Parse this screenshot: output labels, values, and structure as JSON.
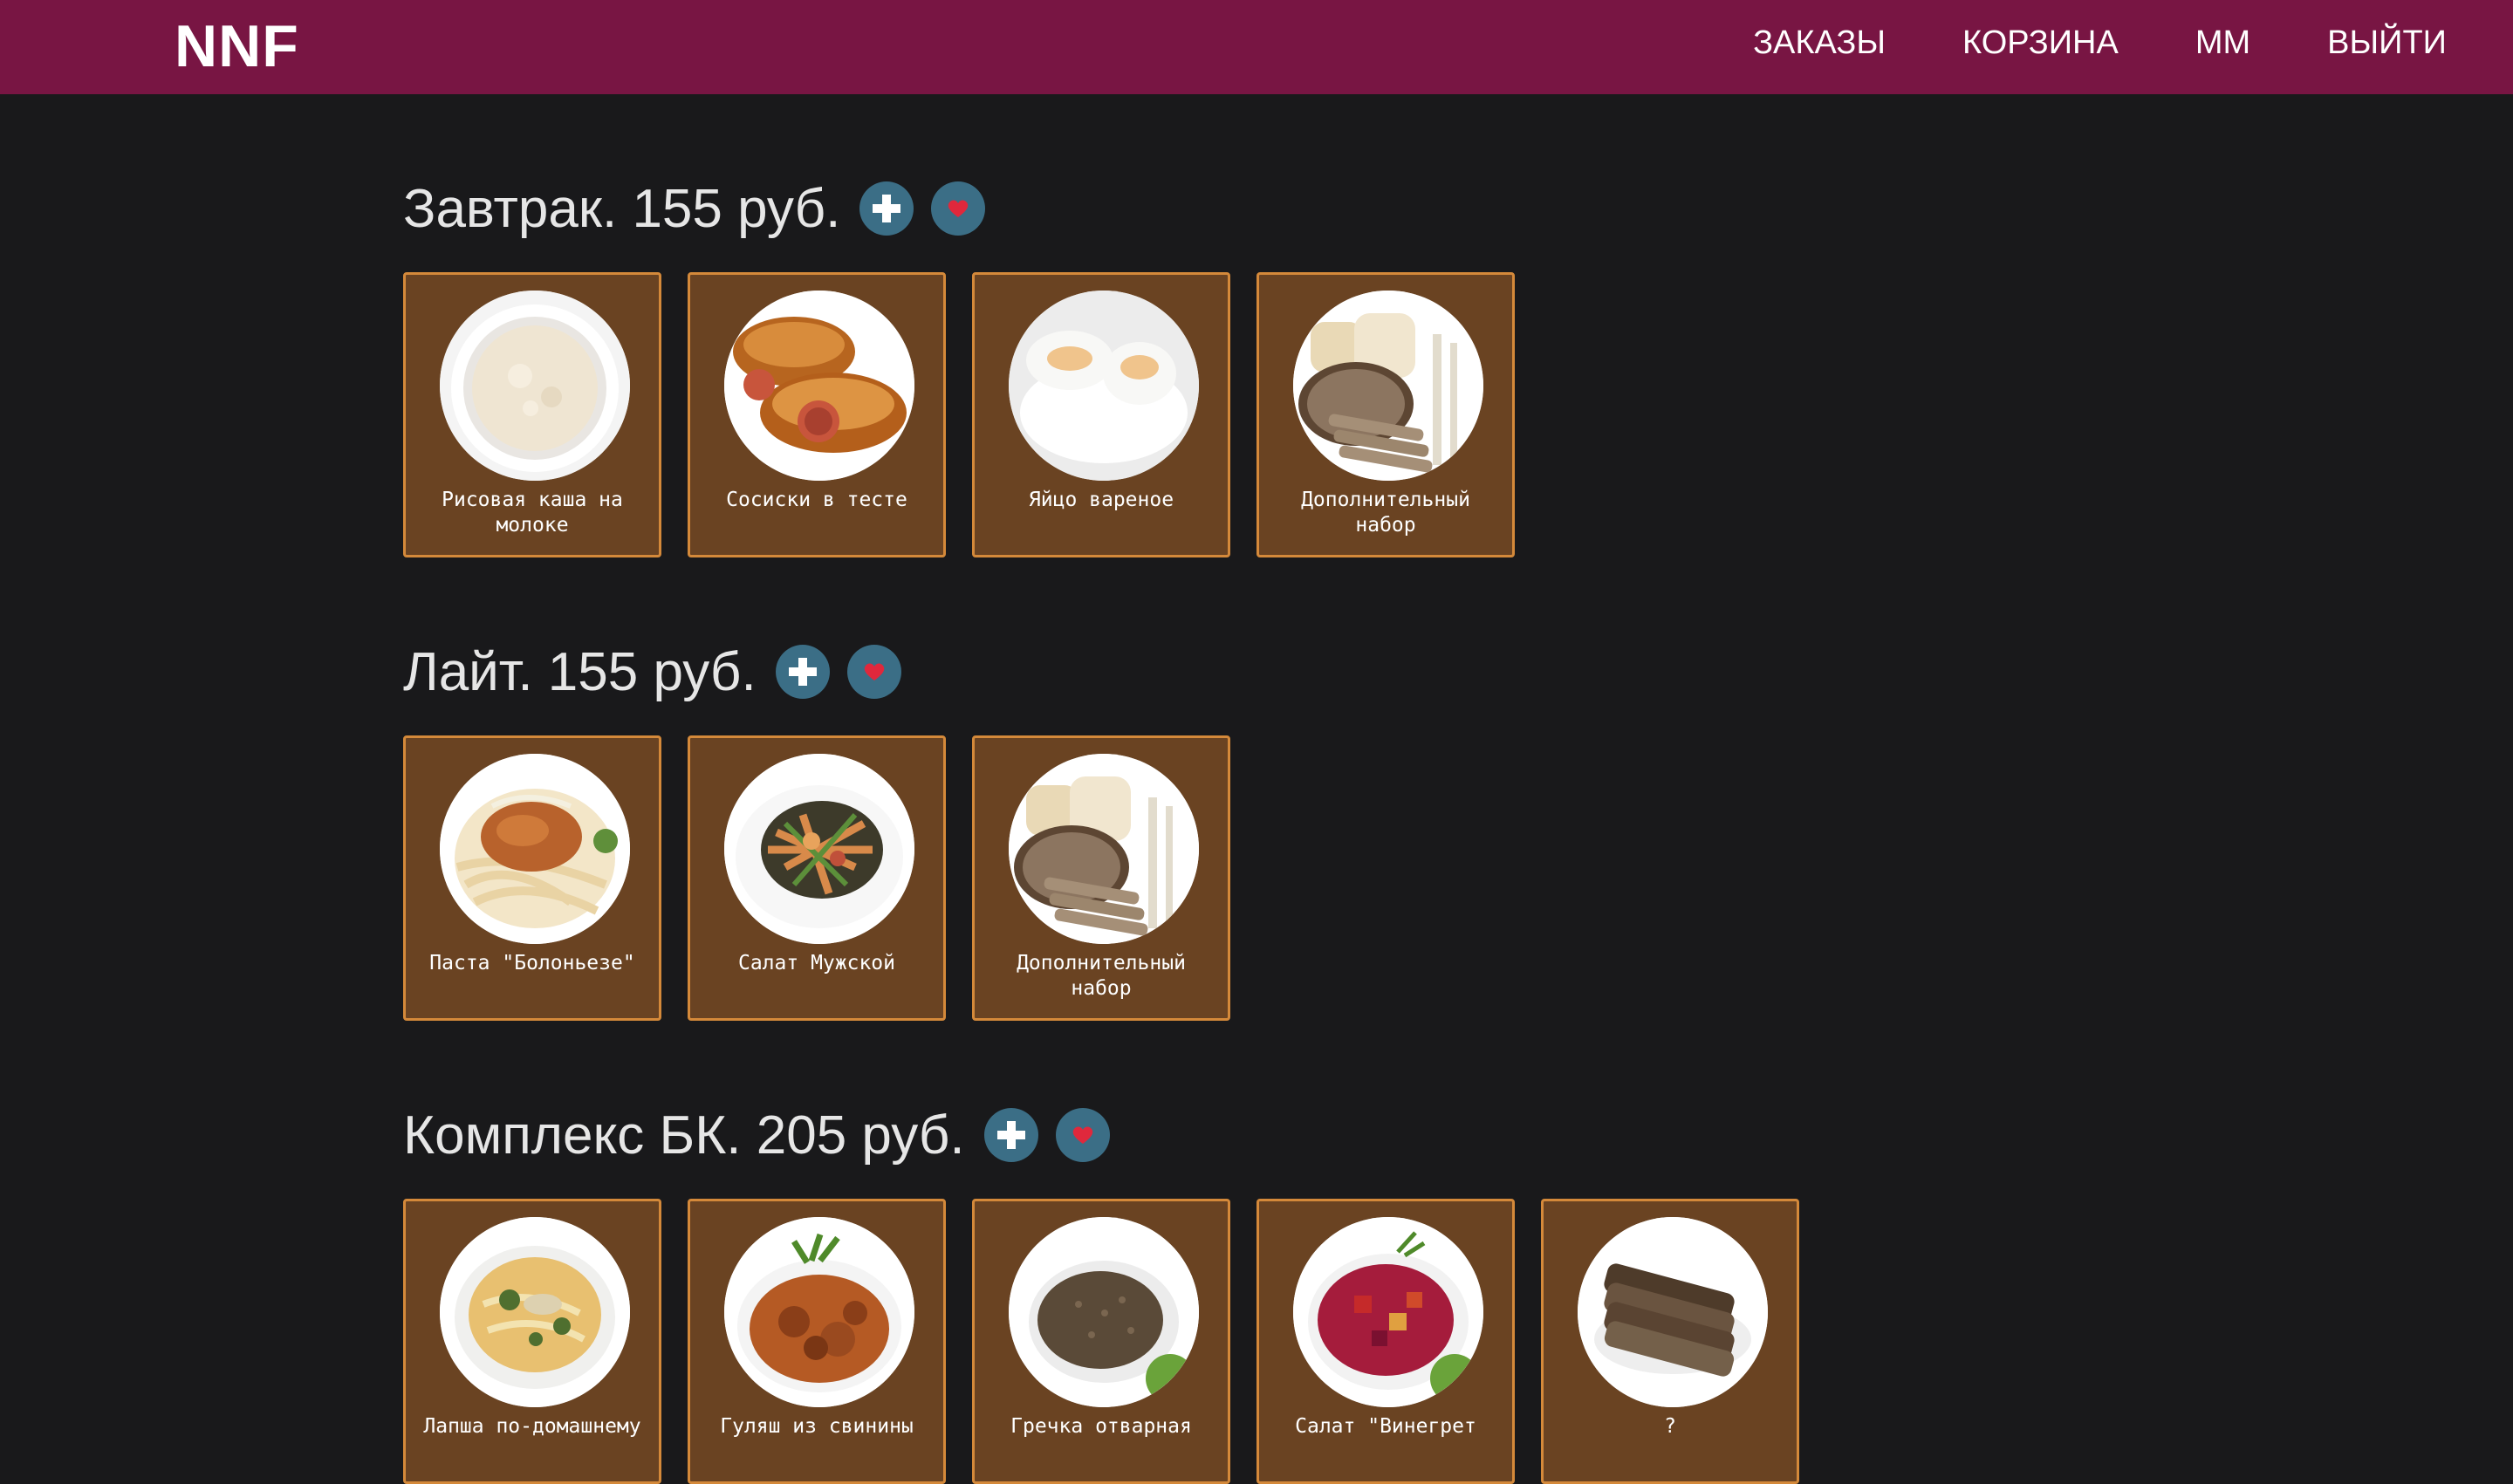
{
  "header": {
    "brand": "NNF",
    "nav": [
      "ЗАКАЗЫ",
      "КОРЗИНА",
      "ММ",
      "ВЫЙТИ"
    ]
  },
  "colors": {
    "navbar": "#781543",
    "background": "#19191b",
    "card_bg": "#6a4322",
    "card_border": "#d4893a",
    "action_button": "#3b6e86",
    "heart": "#e0283c"
  },
  "sections": [
    {
      "title": "Завтрак. 155 руб.",
      "icons": [
        "plus-icon",
        "heart-icon"
      ],
      "items": [
        {
          "name": "Рисовая каша на молоке",
          "image": "rice-porridge"
        },
        {
          "name": "Сосиски в тесте",
          "image": "sausage-rolls"
        },
        {
          "name": "Яйцо вареное",
          "image": "boiled-egg"
        },
        {
          "name": "Дополнительный набор",
          "image": "bread-set"
        }
      ]
    },
    {
      "title": "Лайт. 155 руб.",
      "icons": [
        "plus-icon",
        "heart-icon"
      ],
      "items": [
        {
          "name": "Паста \"Болоньезе\"",
          "image": "pasta-bolognese"
        },
        {
          "name": "Салат Мужской",
          "image": "salad-mens"
        },
        {
          "name": "Дополнительный набор",
          "image": "bread-set"
        }
      ]
    },
    {
      "title": "Комплекс БК. 205 руб.",
      "icons": [
        "plus-icon",
        "heart-icon"
      ],
      "items": [
        {
          "name": "Лапша по-домашнему",
          "image": "noodle-soup"
        },
        {
          "name": "Гуляш из свинины",
          "image": "pork-goulash"
        },
        {
          "name": "Гречка отварная",
          "image": "buckwheat"
        },
        {
          "name": "Салат \"Винегрет",
          "image": "vinaigrette"
        },
        {
          "name": "?",
          "image": "rye-bread"
        }
      ]
    }
  ]
}
